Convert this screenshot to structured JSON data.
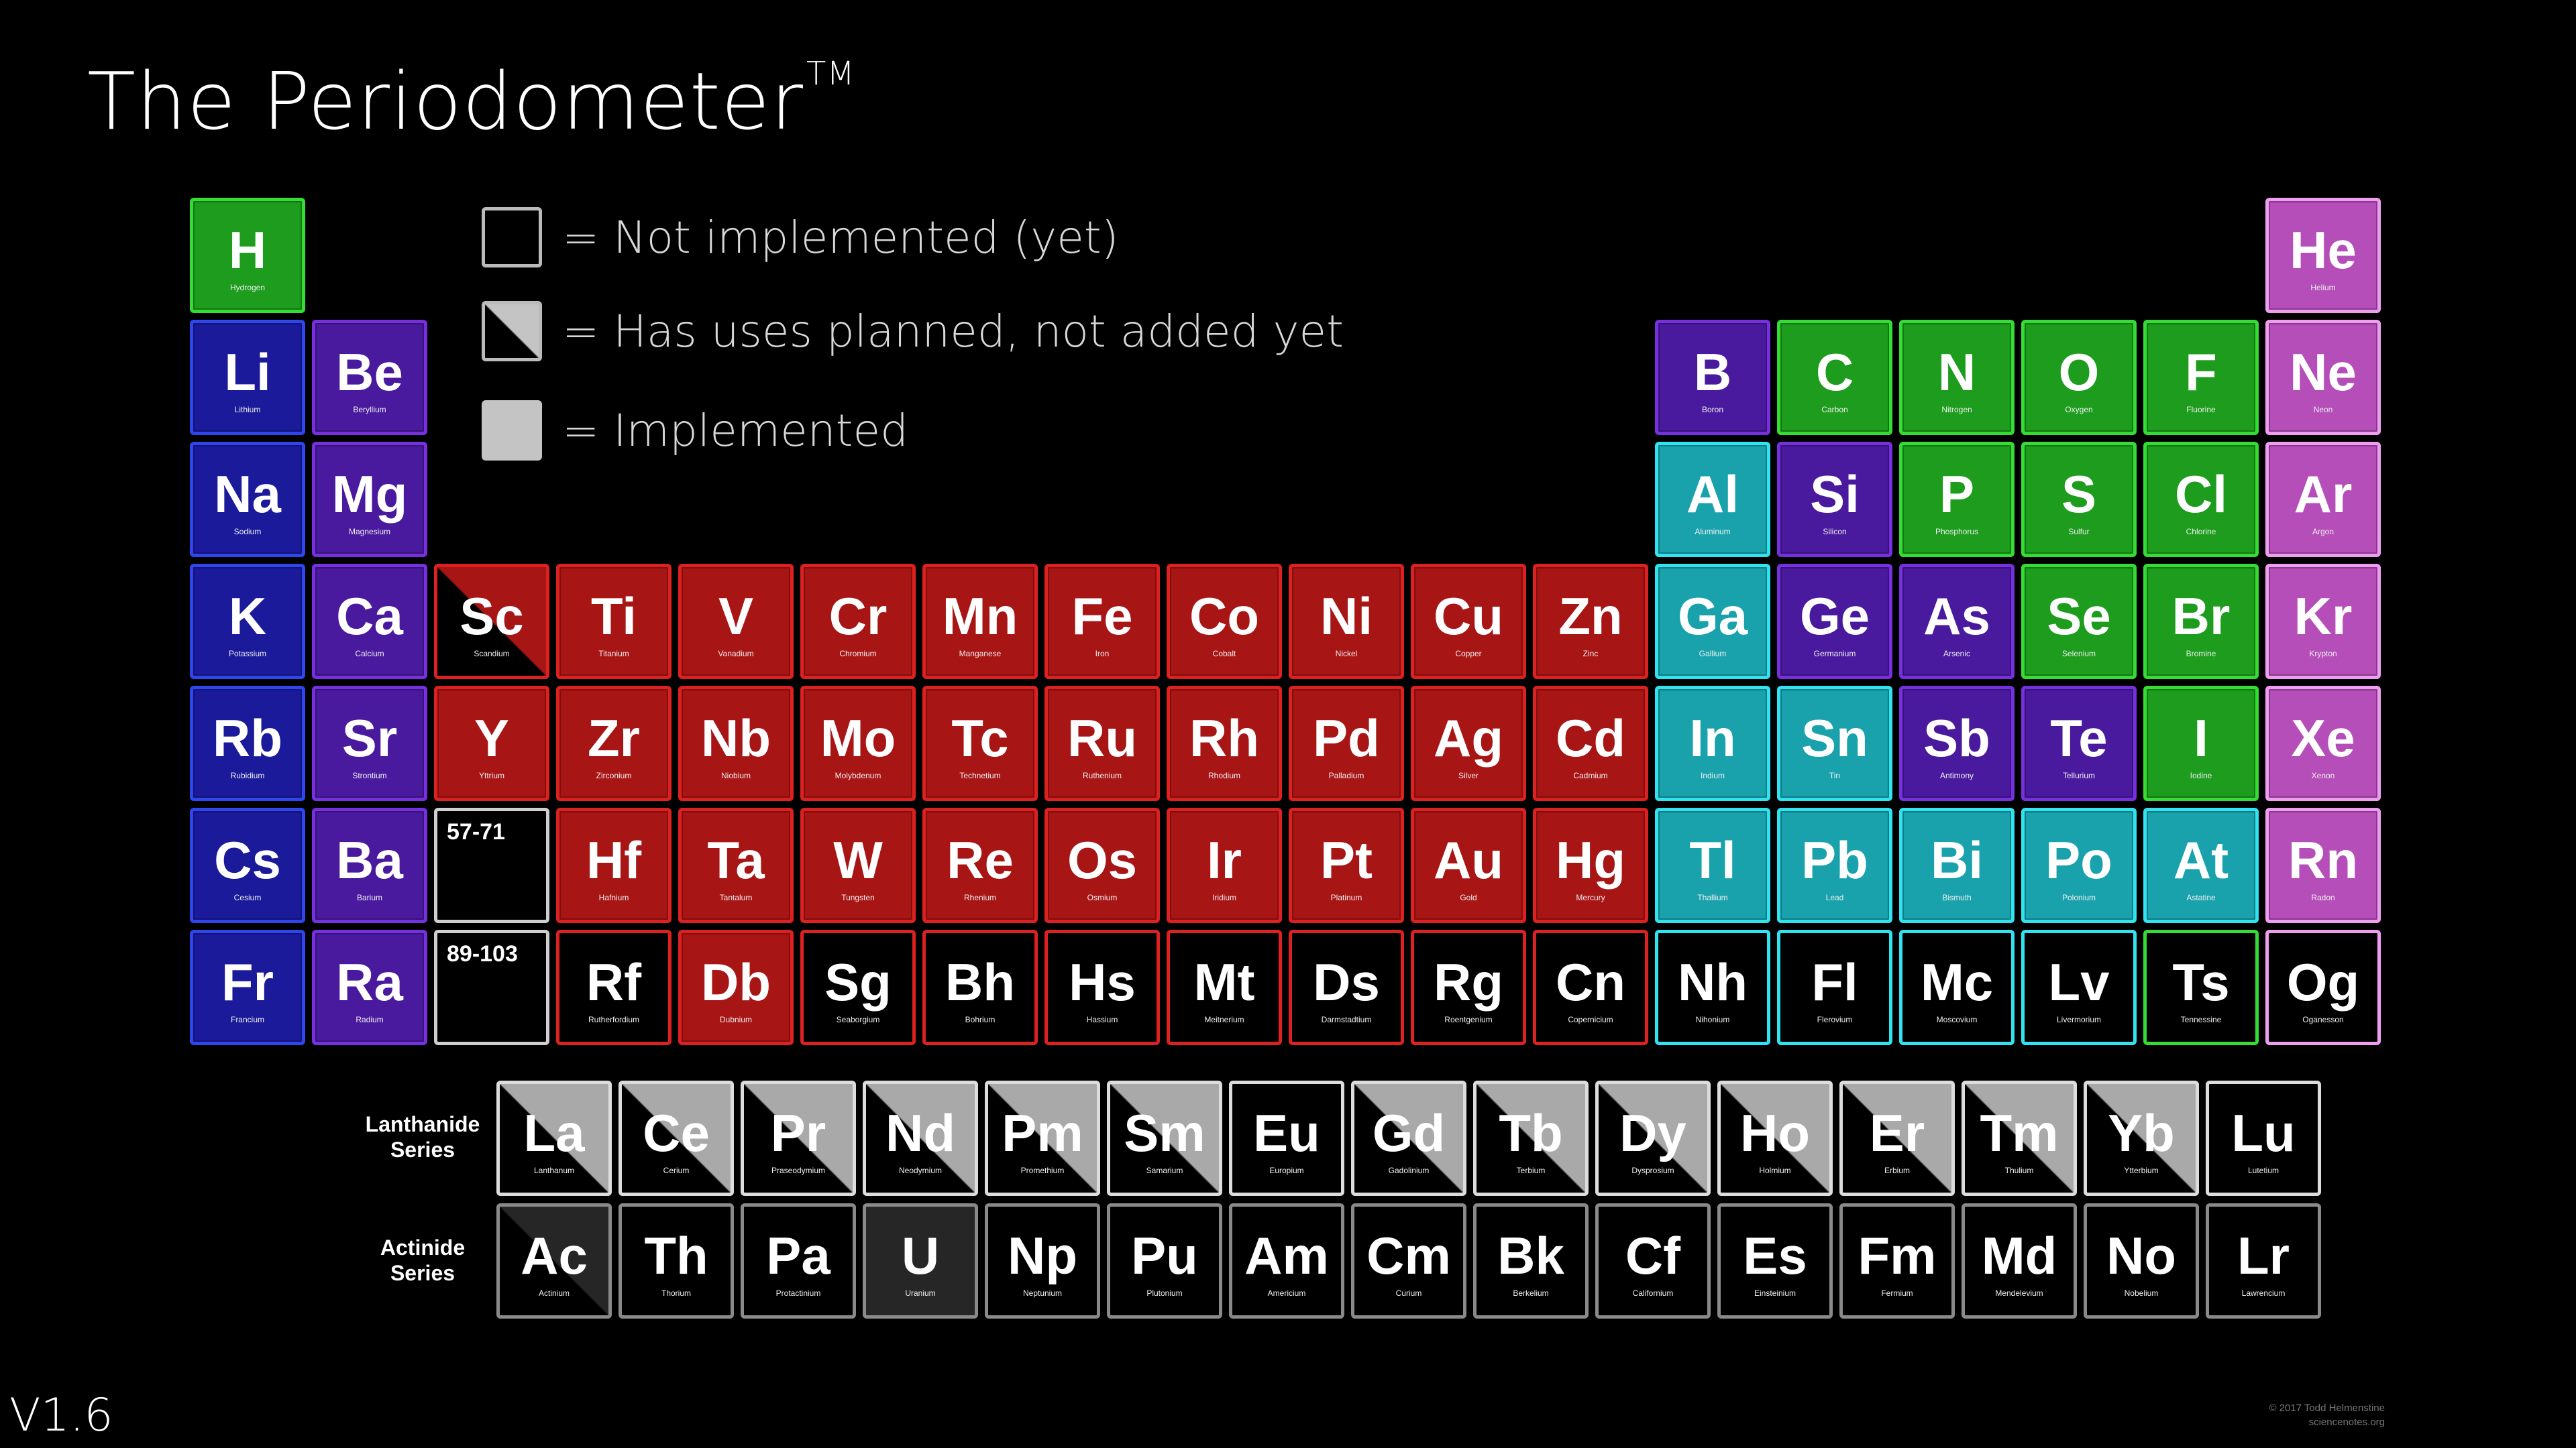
{
  "title": "The Periodometer",
  "title_mark": "TM",
  "legend": [
    {
      "style": "empty",
      "text": "= Not implemented (yet)"
    },
    {
      "style": "half",
      "text": "= Has uses planned, not added yet"
    },
    {
      "style": "full",
      "text": "= Implemented"
    }
  ],
  "category_colors": {
    "green": {
      "fill": "#1d9c1d",
      "border": "#33dd33"
    },
    "blue": {
      "fill": "#1a1a9a",
      "border": "#2f46ee"
    },
    "purple": {
      "fill": "#4a1a9e",
      "border": "#7630e0"
    },
    "red": {
      "fill": "#a81515",
      "border": "#dd2020"
    },
    "cyan": {
      "fill": "#19a2ac",
      "border": "#2fe3f0"
    },
    "pink": {
      "fill": "#b54eb8",
      "border": "#ef9df0"
    },
    "gray": {
      "fill": "#a9a9a9",
      "border": "#dddddd"
    },
    "dark": {
      "fill": "#262626",
      "border": "#8a8a8a"
    }
  },
  "elements": [
    {
      "symbol": "H",
      "name": "Hydrogen",
      "row": 0,
      "col": 0,
      "color": "green",
      "style": "full"
    },
    {
      "symbol": "He",
      "name": "Helium",
      "row": 0,
      "col": 17,
      "color": "pink",
      "style": "full"
    },
    {
      "symbol": "Li",
      "name": "Lithium",
      "row": 1,
      "col": 0,
      "color": "blue",
      "style": "full"
    },
    {
      "symbol": "Be",
      "name": "Beryllium",
      "row": 1,
      "col": 1,
      "color": "purple",
      "style": "full"
    },
    {
      "symbol": "B",
      "name": "Boron",
      "row": 1,
      "col": 12,
      "color": "purple",
      "style": "full"
    },
    {
      "symbol": "C",
      "name": "Carbon",
      "row": 1,
      "col": 13,
      "color": "green",
      "style": "full"
    },
    {
      "symbol": "N",
      "name": "Nitrogen",
      "row": 1,
      "col": 14,
      "color": "green",
      "style": "full"
    },
    {
      "symbol": "O",
      "name": "Oxygen",
      "row": 1,
      "col": 15,
      "color": "green",
      "style": "full"
    },
    {
      "symbol": "F",
      "name": "Fluorine",
      "row": 1,
      "col": 16,
      "color": "green",
      "style": "full"
    },
    {
      "symbol": "Ne",
      "name": "Neon",
      "row": 1,
      "col": 17,
      "color": "pink",
      "style": "full"
    },
    {
      "symbol": "Na",
      "name": "Sodium",
      "row": 2,
      "col": 0,
      "color": "blue",
      "style": "full"
    },
    {
      "symbol": "Mg",
      "name": "Magnesium",
      "row": 2,
      "col": 1,
      "color": "purple",
      "style": "full"
    },
    {
      "symbol": "Al",
      "name": "Aluminum",
      "row": 2,
      "col": 12,
      "color": "cyan",
      "style": "full"
    },
    {
      "symbol": "Si",
      "name": "Silicon",
      "row": 2,
      "col": 13,
      "color": "purple",
      "style": "full"
    },
    {
      "symbol": "P",
      "name": "Phosphorus",
      "row": 2,
      "col": 14,
      "color": "green",
      "style": "full"
    },
    {
      "symbol": "S",
      "name": "Sulfur",
      "row": 2,
      "col": 15,
      "color": "green",
      "style": "full"
    },
    {
      "symbol": "Cl",
      "name": "Chlorine",
      "row": 2,
      "col": 16,
      "color": "green",
      "style": "full"
    },
    {
      "symbol": "Ar",
      "name": "Argon",
      "row": 2,
      "col": 17,
      "color": "pink",
      "style": "full"
    },
    {
      "symbol": "K",
      "name": "Potassium",
      "row": 3,
      "col": 0,
      "color": "blue",
      "style": "full"
    },
    {
      "symbol": "Ca",
      "name": "Calcium",
      "row": 3,
      "col": 1,
      "color": "purple",
      "style": "full"
    },
    {
      "symbol": "Sc",
      "name": "Scandium",
      "row": 3,
      "col": 2,
      "color": "red",
      "style": "half"
    },
    {
      "symbol": "Ti",
      "name": "Titanium",
      "row": 3,
      "col": 3,
      "color": "red",
      "style": "full"
    },
    {
      "symbol": "V",
      "name": "Vanadium",
      "row": 3,
      "col": 4,
      "color": "red",
      "style": "full"
    },
    {
      "symbol": "Cr",
      "name": "Chromium",
      "row": 3,
      "col": 5,
      "color": "red",
      "style": "full"
    },
    {
      "symbol": "Mn",
      "name": "Manganese",
      "row": 3,
      "col": 6,
      "color": "red",
      "style": "full"
    },
    {
      "symbol": "Fe",
      "name": "Iron",
      "row": 3,
      "col": 7,
      "color": "red",
      "style": "full"
    },
    {
      "symbol": "Co",
      "name": "Cobalt",
      "row": 3,
      "col": 8,
      "color": "red",
      "style": "full"
    },
    {
      "symbol": "Ni",
      "name": "Nickel",
      "row": 3,
      "col": 9,
      "color": "red",
      "style": "full"
    },
    {
      "symbol": "Cu",
      "name": "Copper",
      "row": 3,
      "col": 10,
      "color": "red",
      "style": "full"
    },
    {
      "symbol": "Zn",
      "name": "Zinc",
      "row": 3,
      "col": 11,
      "color": "red",
      "style": "full"
    },
    {
      "symbol": "Ga",
      "name": "Gallium",
      "row": 3,
      "col": 12,
      "color": "cyan",
      "style": "full"
    },
    {
      "symbol": "Ge",
      "name": "Germanium",
      "row": 3,
      "col": 13,
      "color": "purple",
      "style": "full"
    },
    {
      "symbol": "As",
      "name": "Arsenic",
      "row": 3,
      "col": 14,
      "color": "purple",
      "style": "full"
    },
    {
      "symbol": "Se",
      "name": "Selenium",
      "row": 3,
      "col": 15,
      "color": "green",
      "style": "full"
    },
    {
      "symbol": "Br",
      "name": "Bromine",
      "row": 3,
      "col": 16,
      "color": "green",
      "style": "full"
    },
    {
      "symbol": "Kr",
      "name": "Krypton",
      "row": 3,
      "col": 17,
      "color": "pink",
      "style": "full"
    },
    {
      "symbol": "Rb",
      "name": "Rubidium",
      "row": 4,
      "col": 0,
      "color": "blue",
      "style": "full"
    },
    {
      "symbol": "Sr",
      "name": "Strontium",
      "row": 4,
      "col": 1,
      "color": "purple",
      "style": "full"
    },
    {
      "symbol": "Y",
      "name": "Yttrium",
      "row": 4,
      "col": 2,
      "color": "red",
      "style": "full"
    },
    {
      "symbol": "Zr",
      "name": "Zirconium",
      "row": 4,
      "col": 3,
      "color": "red",
      "style": "full"
    },
    {
      "symbol": "Nb",
      "name": "Niobium",
      "row": 4,
      "col": 4,
      "color": "red",
      "style": "full"
    },
    {
      "symbol": "Mo",
      "name": "Molybdenum",
      "row": 4,
      "col": 5,
      "color": "red",
      "style": "full"
    },
    {
      "symbol": "Tc",
      "name": "Technetium",
      "row": 4,
      "col": 6,
      "color": "red",
      "style": "full"
    },
    {
      "symbol": "Ru",
      "name": "Ruthenium",
      "row": 4,
      "col": 7,
      "color": "red",
      "style": "full"
    },
    {
      "symbol": "Rh",
      "name": "Rhodium",
      "row": 4,
      "col": 8,
      "color": "red",
      "style": "full"
    },
    {
      "symbol": "Pd",
      "name": "Palladium",
      "row": 4,
      "col": 9,
      "color": "red",
      "style": "full"
    },
    {
      "symbol": "Ag",
      "name": "Silver",
      "row": 4,
      "col": 10,
      "color": "red",
      "style": "full"
    },
    {
      "symbol": "Cd",
      "name": "Cadmium",
      "row": 4,
      "col": 11,
      "color": "red",
      "style": "full"
    },
    {
      "symbol": "In",
      "name": "Indium",
      "row": 4,
      "col": 12,
      "color": "cyan",
      "style": "full"
    },
    {
      "symbol": "Sn",
      "name": "Tin",
      "row": 4,
      "col": 13,
      "color": "cyan",
      "style": "full"
    },
    {
      "symbol": "Sb",
      "name": "Antimony",
      "row": 4,
      "col": 14,
      "color": "purple",
      "style": "full"
    },
    {
      "symbol": "Te",
      "name": "Tellurium",
      "row": 4,
      "col": 15,
      "color": "purple",
      "style": "full"
    },
    {
      "symbol": "I",
      "name": "Iodine",
      "row": 4,
      "col": 16,
      "color": "green",
      "style": "full"
    },
    {
      "symbol": "Xe",
      "name": "Xenon",
      "row": 4,
      "col": 17,
      "color": "pink",
      "style": "full"
    },
    {
      "symbol": "Cs",
      "name": "Cesium",
      "row": 5,
      "col": 0,
      "color": "blue",
      "style": "full"
    },
    {
      "symbol": "Ba",
      "name": "Barium",
      "row": 5,
      "col": 1,
      "color": "purple",
      "style": "full"
    },
    {
      "symbol": "Hf",
      "name": "Hafnium",
      "row": 5,
      "col": 3,
      "color": "red",
      "style": "full"
    },
    {
      "symbol": "Ta",
      "name": "Tantalum",
      "row": 5,
      "col": 4,
      "color": "red",
      "style": "full"
    },
    {
      "symbol": "W",
      "name": "Tungsten",
      "row": 5,
      "col": 5,
      "color": "red",
      "style": "full"
    },
    {
      "symbol": "Re",
      "name": "Rhenium",
      "row": 5,
      "col": 6,
      "color": "red",
      "style": "full"
    },
    {
      "symbol": "Os",
      "name": "Osmium",
      "row": 5,
      "col": 7,
      "color": "red",
      "style": "full"
    },
    {
      "symbol": "Ir",
      "name": "Iridium",
      "row": 5,
      "col": 8,
      "color": "red",
      "style": "full"
    },
    {
      "symbol": "Pt",
      "name": "Platinum",
      "row": 5,
      "col": 9,
      "color": "red",
      "style": "full"
    },
    {
      "symbol": "Au",
      "name": "Gold",
      "row": 5,
      "col": 10,
      "color": "red",
      "style": "full"
    },
    {
      "symbol": "Hg",
      "name": "Mercury",
      "row": 5,
      "col": 11,
      "color": "red",
      "style": "full"
    },
    {
      "symbol": "Tl",
      "name": "Thallium",
      "row": 5,
      "col": 12,
      "color": "cyan",
      "style": "full"
    },
    {
      "symbol": "Pb",
      "name": "Lead",
      "row": 5,
      "col": 13,
      "color": "cyan",
      "style": "full"
    },
    {
      "symbol": "Bi",
      "name": "Bismuth",
      "row": 5,
      "col": 14,
      "color": "cyan",
      "style": "full"
    },
    {
      "symbol": "Po",
      "name": "Polonium",
      "row": 5,
      "col": 15,
      "color": "cyan",
      "style": "full"
    },
    {
      "symbol": "At",
      "name": "Astatine",
      "row": 5,
      "col": 16,
      "color": "cyan",
      "style": "full"
    },
    {
      "symbol": "Rn",
      "name": "Radon",
      "row": 5,
      "col": 17,
      "color": "pink",
      "style": "full"
    },
    {
      "symbol": "Fr",
      "name": "Francium",
      "row": 6,
      "col": 0,
      "color": "blue",
      "style": "full"
    },
    {
      "symbol": "Ra",
      "name": "Radium",
      "row": 6,
      "col": 1,
      "color": "purple",
      "style": "full"
    },
    {
      "symbol": "Rf",
      "name": "Rutherfordium",
      "row": 6,
      "col": 3,
      "color": "red",
      "style": "empty"
    },
    {
      "symbol": "Db",
      "name": "Dubnium",
      "row": 6,
      "col": 4,
      "color": "red",
      "style": "full"
    },
    {
      "symbol": "Sg",
      "name": "Seaborgium",
      "row": 6,
      "col": 5,
      "color": "red",
      "style": "empty"
    },
    {
      "symbol": "Bh",
      "name": "Bohrium",
      "row": 6,
      "col": 6,
      "color": "red",
      "style": "empty"
    },
    {
      "symbol": "Hs",
      "name": "Hassium",
      "row": 6,
      "col": 7,
      "color": "red",
      "style": "empty"
    },
    {
      "symbol": "Mt",
      "name": "Meitnerium",
      "row": 6,
      "col": 8,
      "color": "red",
      "style": "empty"
    },
    {
      "symbol": "Ds",
      "name": "Darmstadtium",
      "row": 6,
      "col": 9,
      "color": "red",
      "style": "empty"
    },
    {
      "symbol": "Rg",
      "name": "Roentgenium",
      "row": 6,
      "col": 10,
      "color": "red",
      "style": "empty"
    },
    {
      "symbol": "Cn",
      "name": "Copernicium",
      "row": 6,
      "col": 11,
      "color": "red",
      "style": "empty"
    },
    {
      "symbol": "Nh",
      "name": "Nihonium",
      "row": 6,
      "col": 12,
      "color": "cyan",
      "style": "empty"
    },
    {
      "symbol": "Fl",
      "name": "Flerovium",
      "row": 6,
      "col": 13,
      "color": "cyan",
      "style": "empty"
    },
    {
      "symbol": "Mc",
      "name": "Moscovium",
      "row": 6,
      "col": 14,
      "color": "cyan",
      "style": "empty"
    },
    {
      "symbol": "Lv",
      "name": "Livermorium",
      "row": 6,
      "col": 15,
      "color": "cyan",
      "style": "empty"
    },
    {
      "symbol": "Ts",
      "name": "Tennessine",
      "row": 6,
      "col": 16,
      "color": "green",
      "style": "empty"
    },
    {
      "symbol": "Og",
      "name": "Oganesson",
      "row": 6,
      "col": 17,
      "color": "pink",
      "style": "empty"
    }
  ],
  "range_cells": [
    {
      "text": "57-71",
      "row": 5,
      "col": 2
    },
    {
      "text": "89-103",
      "row": 6,
      "col": 2
    }
  ],
  "series_labels": {
    "lanthanide": [
      "Lanthanide",
      "Series"
    ],
    "actinide": [
      "Actinide",
      "Series"
    ]
  },
  "lanthanides": [
    {
      "symbol": "La",
      "name": "Lanthanum",
      "style": "half"
    },
    {
      "symbol": "Ce",
      "name": "Cerium",
      "style": "half"
    },
    {
      "symbol": "Pr",
      "name": "Praseodymium",
      "style": "half"
    },
    {
      "symbol": "Nd",
      "name": "Neodymium",
      "style": "half"
    },
    {
      "symbol": "Pm",
      "name": "Promethium",
      "style": "half"
    },
    {
      "symbol": "Sm",
      "name": "Samarium",
      "style": "half"
    },
    {
      "symbol": "Eu",
      "name": "Europium",
      "style": "empty"
    },
    {
      "symbol": "Gd",
      "name": "Gadolinium",
      "style": "half"
    },
    {
      "symbol": "Tb",
      "name": "Terbium",
      "style": "half"
    },
    {
      "symbol": "Dy",
      "name": "Dysprosium",
      "style": "half"
    },
    {
      "symbol": "Ho",
      "name": "Holmium",
      "style": "half"
    },
    {
      "symbol": "Er",
      "name": "Erbium",
      "style": "half"
    },
    {
      "symbol": "Tm",
      "name": "Thulium",
      "style": "half"
    },
    {
      "symbol": "Yb",
      "name": "Ytterbium",
      "style": "half"
    },
    {
      "symbol": "Lu",
      "name": "Lutetium",
      "style": "empty"
    }
  ],
  "actinides": [
    {
      "symbol": "Ac",
      "name": "Actinium",
      "style": "half"
    },
    {
      "symbol": "Th",
      "name": "Thorium",
      "style": "empty"
    },
    {
      "symbol": "Pa",
      "name": "Protactinium",
      "style": "empty"
    },
    {
      "symbol": "U",
      "name": "Uranium",
      "style": "dark"
    },
    {
      "symbol": "Np",
      "name": "Neptunium",
      "style": "empty"
    },
    {
      "symbol": "Pu",
      "name": "Plutonium",
      "style": "empty"
    },
    {
      "symbol": "Am",
      "name": "Americium",
      "style": "empty"
    },
    {
      "symbol": "Cm",
      "name": "Curium",
      "style": "empty"
    },
    {
      "symbol": "Bk",
      "name": "Berkelium",
      "style": "empty"
    },
    {
      "symbol": "Cf",
      "name": "Californium",
      "style": "empty"
    },
    {
      "symbol": "Es",
      "name": "Einsteinium",
      "style": "empty"
    },
    {
      "symbol": "Fm",
      "name": "Fermium",
      "style": "empty"
    },
    {
      "symbol": "Md",
      "name": "Mendelevium",
      "style": "empty"
    },
    {
      "symbol": "No",
      "name": "Nobelium",
      "style": "empty"
    },
    {
      "symbol": "Lr",
      "name": "Lawrencium",
      "style": "empty"
    }
  ],
  "version": "V1.6",
  "credit": [
    "© 2017 Todd Helmenstine",
    "sciencenotes.org"
  ]
}
